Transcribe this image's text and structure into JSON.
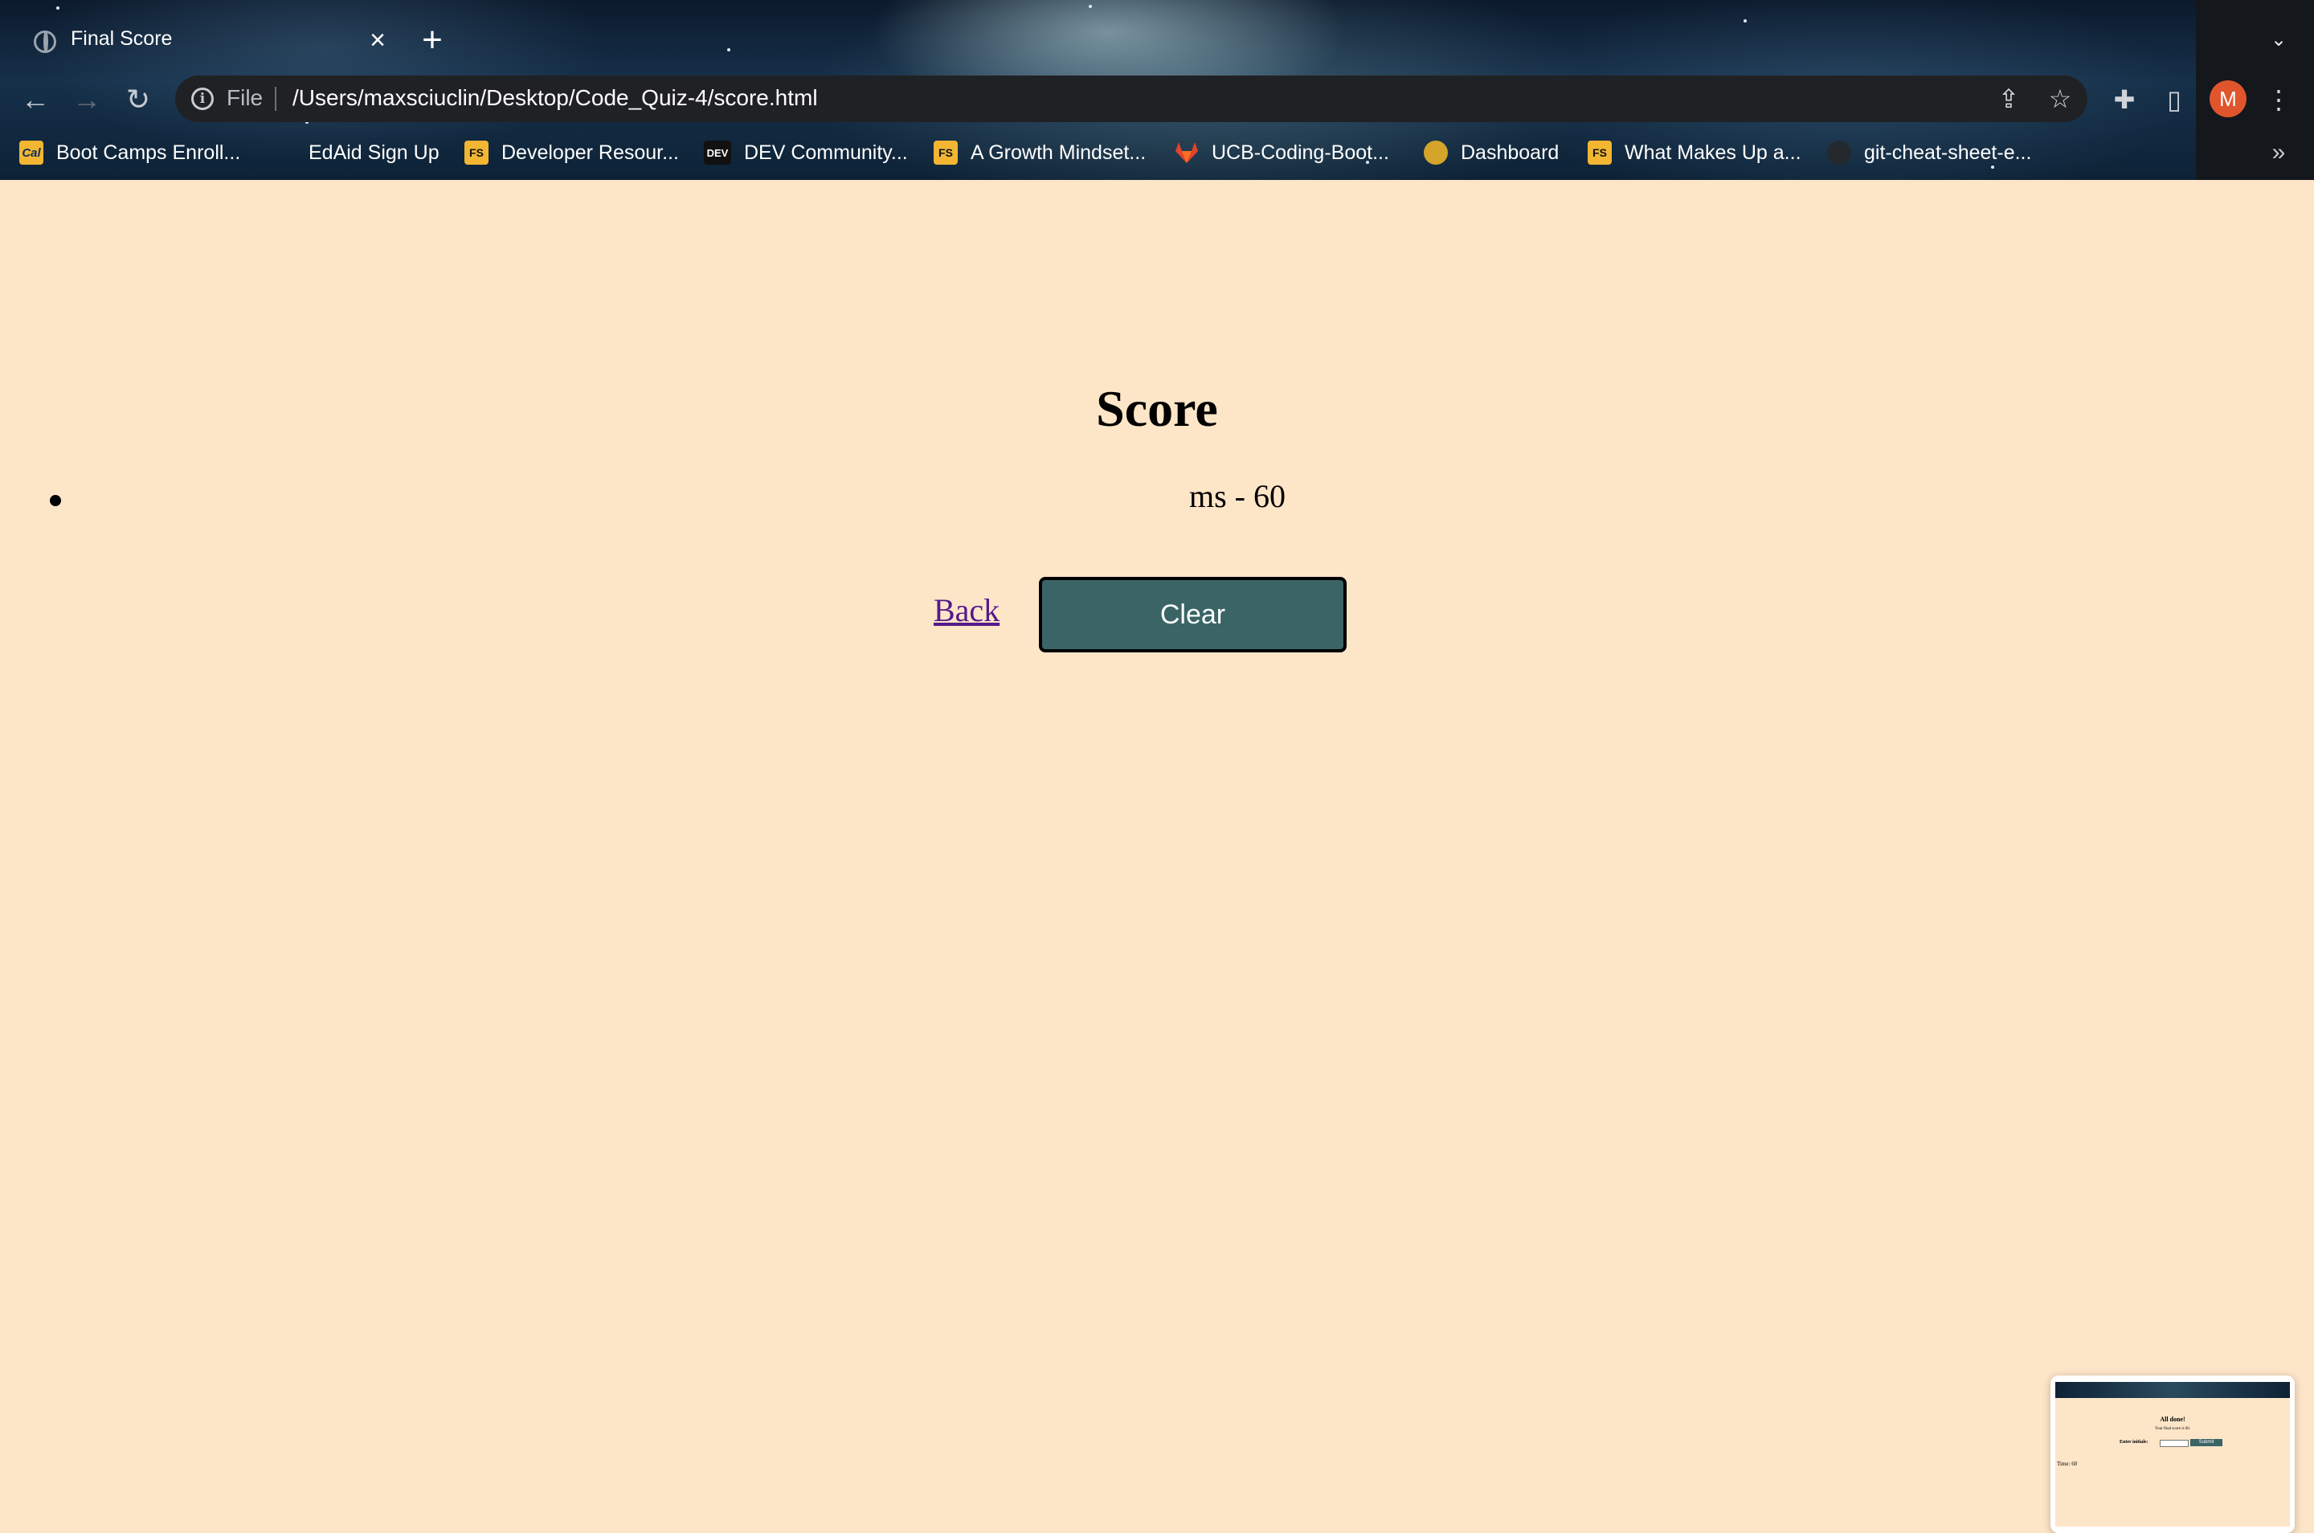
{
  "browser": {
    "tab": {
      "title": "Final Score",
      "close_glyph": "×",
      "icon": "globe-icon"
    },
    "new_tab_glyph": "+",
    "tab_list_glyph": "⌄",
    "nav": {
      "back_glyph": "←",
      "forward_glyph": "→",
      "reload_glyph": "↻"
    },
    "omnibox": {
      "scheme_label": "File",
      "url": "/Users/maxsciuclin/Desktop/Code_Quiz-4/score.html",
      "share_glyph": "⇪",
      "bookmark_glyph": "☆"
    },
    "toolbar": {
      "extensions_glyph": "✚",
      "sidepanel_glyph": "▯",
      "avatar_initial": "M",
      "avatar_color": "#e0552b",
      "menu_glyph": "⋮"
    },
    "bookmarks": [
      {
        "label": "Boot Camps Enroll...",
        "icon": "cal-icon",
        "badge": "Cal",
        "color": "#f2b632"
      },
      {
        "label": "EdAid Sign Up",
        "icon": "edaid-icon",
        "badge": "",
        "color": ""
      },
      {
        "label": "Developer Resour...",
        "icon": "fs-icon",
        "badge": "FS",
        "color": "#f2b632"
      },
      {
        "label": "DEV Community...",
        "icon": "dev-icon",
        "badge": "DEV",
        "color": "#111111"
      },
      {
        "label": "A Growth Mindset...",
        "icon": "fs-icon",
        "badge": "FS",
        "color": "#f2b632"
      },
      {
        "label": "UCB-Coding-Boot...",
        "icon": "gitlab-icon",
        "badge": "",
        "color": "#e24329"
      },
      {
        "label": "Dashboard",
        "icon": "dashboard-icon",
        "badge": "",
        "color": "#d4a52a"
      },
      {
        "label": "What Makes Up a...",
        "icon": "fs-icon",
        "badge": "FS",
        "color": "#f2b632"
      },
      {
        "label": "git-cheat-sheet-e...",
        "icon": "github-icon",
        "badge": "",
        "color": "#24292e"
      }
    ],
    "bookmarks_more_glyph": "»"
  },
  "page": {
    "background": "#fde5c8",
    "heading": "Score",
    "scores": [
      "ms - 60"
    ],
    "back_label": "Back",
    "clear_label": "Clear",
    "clear_color": "#3a6465"
  },
  "preview": {
    "title": "All done!",
    "subtitle": "Your final score is 60.",
    "label": "Enter initials:",
    "button": "Submit",
    "time": "Time: 60"
  }
}
